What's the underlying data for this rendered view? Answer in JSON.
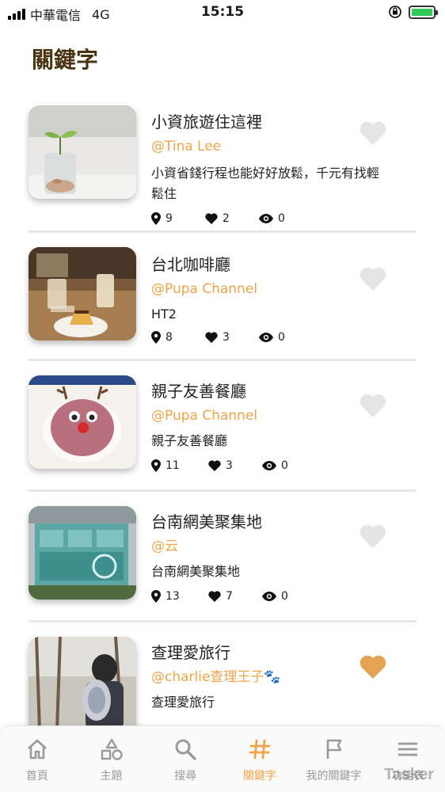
{
  "status": {
    "carrier": "中華電信",
    "network": "4G",
    "time": "15:15"
  },
  "page_title": "關鍵字",
  "colors": {
    "accent": "#f0a447",
    "title": "#4a3311",
    "heart_inactive": "#e5e5e5"
  },
  "items": [
    {
      "title": "小資旅遊住這裡",
      "author": "@Tina Lee",
      "desc": "小資省錢行程也能好好放鬆，千元有找輕鬆住",
      "places": "9",
      "likes": "2",
      "views": "0",
      "favorited": false,
      "thumb": "plant-in-coin-jar"
    },
    {
      "title": "台北咖啡廳",
      "author": "@Pupa Channel",
      "desc": "HT2",
      "places": "8",
      "likes": "3",
      "views": "0",
      "favorited": false,
      "thumb": "coffee-and-pudding"
    },
    {
      "title": "親子友善餐廳",
      "author": "@Pupa Channel",
      "desc": "親子友善餐廳",
      "places": "11",
      "likes": "3",
      "views": "0",
      "favorited": false,
      "thumb": "reindeer-cake"
    },
    {
      "title": "台南網美聚集地",
      "author": "@云",
      "desc": "台南網美聚集地",
      "places": "13",
      "likes": "7",
      "views": "0",
      "favorited": false,
      "thumb": "teal-building"
    },
    {
      "title": "查理愛旅行",
      "author": "@charlie查理王子🐾",
      "desc": "查理愛旅行",
      "places": "",
      "likes": "",
      "views": "",
      "favorited": true,
      "thumb": "person-with-pet-backpack"
    }
  ],
  "tabs": [
    {
      "label": "首頁",
      "icon": "home-icon",
      "active": false
    },
    {
      "label": "主題",
      "icon": "shapes-icon",
      "active": false
    },
    {
      "label": "搜尋",
      "icon": "search-icon",
      "active": false
    },
    {
      "label": "關鍵字",
      "icon": "hashtag-icon",
      "active": true
    },
    {
      "label": "我的關鍵字",
      "icon": "flag-icon",
      "active": false
    },
    {
      "label": "功能表",
      "icon": "menu-icon",
      "active": false
    }
  ],
  "watermark": "Tasker"
}
